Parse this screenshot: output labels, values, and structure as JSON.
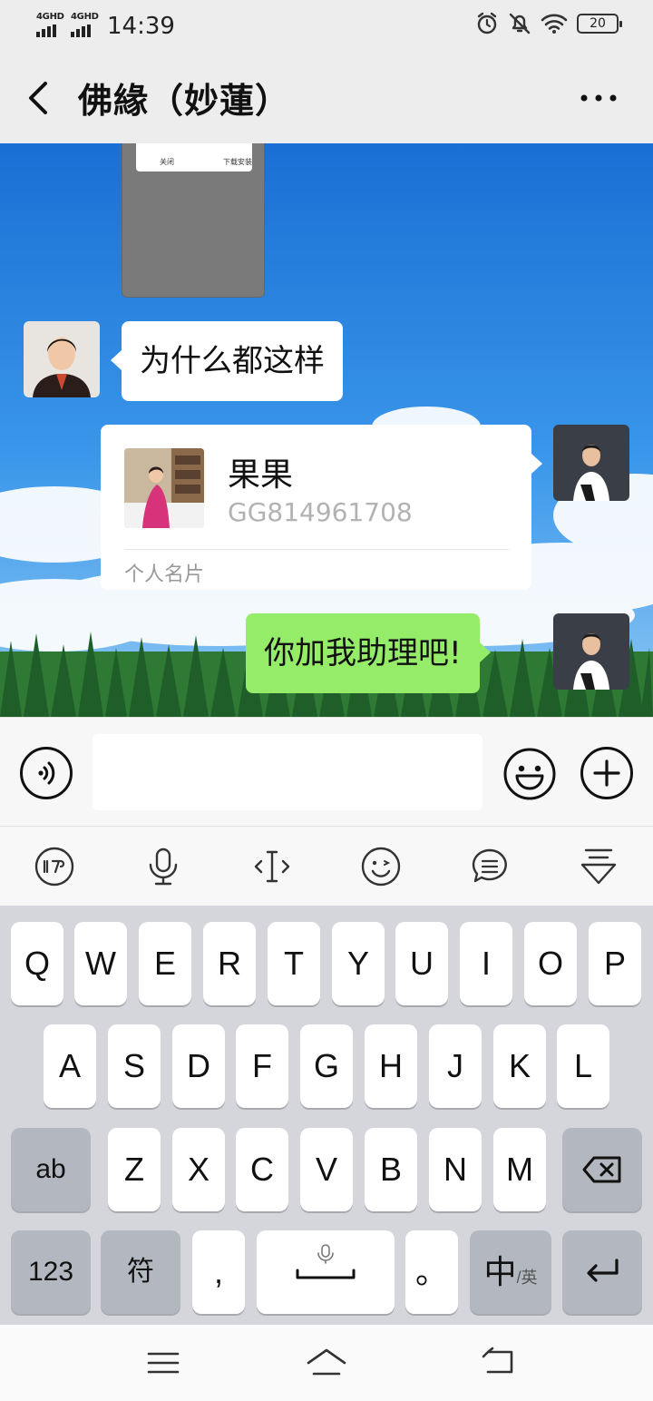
{
  "status_bar": {
    "sim1_label": "4GHD",
    "sim2_label": "4GHD",
    "time": "14:39",
    "battery": "20"
  },
  "header": {
    "title": "佛緣（妙蓮）"
  },
  "messages": {
    "thumb_text_left": "关闭",
    "thumb_text_right": "下载安装",
    "incoming_text": "为什么都这样",
    "card_name": "果果",
    "card_id": "GG814961708",
    "card_type": "个人名片",
    "outgoing_text": "你加我助理吧!"
  },
  "colors": {
    "sent_bubble": "#95ec69",
    "received_bubble": "#ffffff",
    "chrome": "#ededed"
  },
  "input_bar": {
    "placeholder": ""
  },
  "keyboard": {
    "row1": [
      "Q",
      "W",
      "E",
      "R",
      "T",
      "Y",
      "U",
      "I",
      "O",
      "P"
    ],
    "row2": [
      "A",
      "S",
      "D",
      "F",
      "G",
      "H",
      "J",
      "K",
      "L"
    ],
    "row3": [
      "Z",
      "X",
      "C",
      "V",
      "B",
      "N",
      "M"
    ],
    "ab_key": "ab",
    "num_key": "123",
    "symbol_key": "符",
    "comma_key": ",",
    "period_key": "。",
    "lang_main": "中",
    "lang_sub": "/英"
  },
  "icons": {
    "toolbar": [
      "xunfei-icon",
      "microphone-icon",
      "cursor-icon",
      "emoji-icon",
      "message-icon",
      "collapse-keyboard-icon"
    ],
    "nav": [
      "menu-icon",
      "home-icon",
      "back-icon"
    ]
  }
}
